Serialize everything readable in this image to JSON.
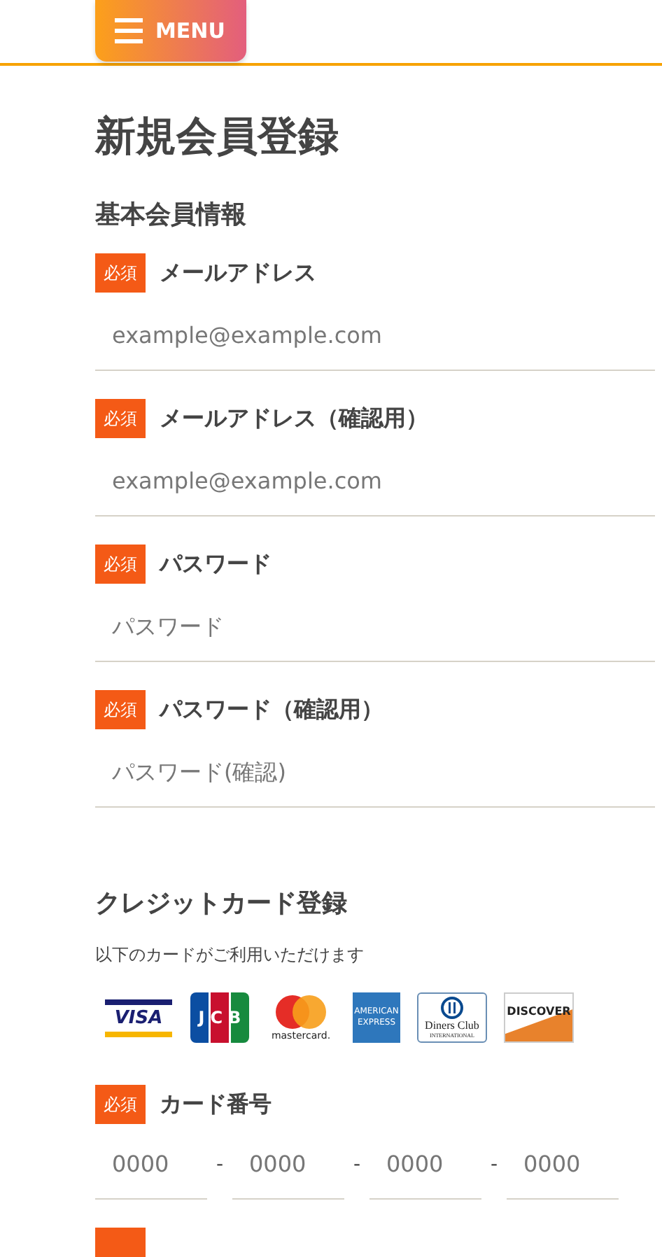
{
  "header": {
    "menu_button": {
      "label": "MENU"
    }
  },
  "title": "新規会員登録",
  "sections": [
    {
      "heading": "基本会員情報",
      "fields": [
        {
          "badge": "必須",
          "label": "メールアドレス",
          "placeholder": "example@example.com"
        },
        {
          "badge": "必須",
          "label": "メールアドレス（確認用）",
          "placeholder": "example@example.com"
        },
        {
          "badge": "必須",
          "label": "パスワード",
          "placeholder": "パスワード"
        },
        {
          "badge": "必須",
          "label": "パスワード（確認用）",
          "placeholder": "パスワード(確認)"
        }
      ]
    },
    {
      "heading": "クレジットカード登録",
      "note": "以下のカードがご利用いただけます",
      "cards": [
        {
          "kind": "visa",
          "label": "VISA"
        },
        {
          "kind": "jcb",
          "label": "JCB"
        },
        {
          "kind": "mastercard",
          "label": "mastercard."
        },
        {
          "kind": "amex",
          "label": "AMERICAN EXPRESS"
        },
        {
          "kind": "diners",
          "label": "Diners Club",
          "sub": "INTERNATIONAL"
        },
        {
          "kind": "discover",
          "label": "DISCOVER"
        }
      ],
      "card_number": {
        "badge": "必須",
        "label": "カード番号",
        "separator": "-",
        "parts": [
          {
            "placeholder": "0000"
          },
          {
            "placeholder": "0000"
          },
          {
            "placeholder": "0000"
          },
          {
            "placeholder": "0000"
          }
        ]
      }
    }
  ]
}
